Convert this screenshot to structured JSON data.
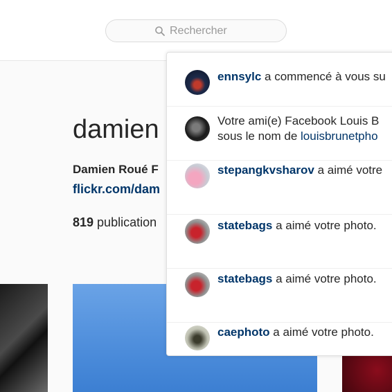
{
  "search": {
    "placeholder": "Rechercher"
  },
  "profile": {
    "username": "damien",
    "fullname": "Damien Roué F",
    "link": "flickr.com/dam",
    "stats_count": "819",
    "stats_label": " publication"
  },
  "notifications": [
    {
      "segments": [
        {
          "type": "user",
          "text": "ennsylc"
        },
        {
          "type": "text",
          "text": " a commencé à vous su"
        }
      ]
    },
    {
      "lines": [
        [
          {
            "type": "text",
            "text": "Votre ami(e) Facebook Louis B"
          }
        ],
        [
          {
            "type": "text",
            "text": "sous le nom de "
          },
          {
            "type": "link",
            "text": "louisbrunetpho"
          }
        ]
      ]
    },
    {
      "segments": [
        {
          "type": "user",
          "text": "stepangkvsharov"
        },
        {
          "type": "text",
          "text": " a aimé votre"
        }
      ]
    },
    {
      "segments": [
        {
          "type": "user",
          "text": "statebags"
        },
        {
          "type": "text",
          "text": " a aimé votre photo."
        }
      ]
    },
    {
      "segments": [
        {
          "type": "user",
          "text": "statebags"
        },
        {
          "type": "text",
          "text": " a aimé votre photo."
        }
      ]
    },
    {
      "segments": [
        {
          "type": "user",
          "text": "caephoto"
        },
        {
          "type": "text",
          "text": " a aimé votre photo."
        }
      ]
    }
  ],
  "colors": {
    "link": "#003569",
    "placeholder": "#999999"
  }
}
